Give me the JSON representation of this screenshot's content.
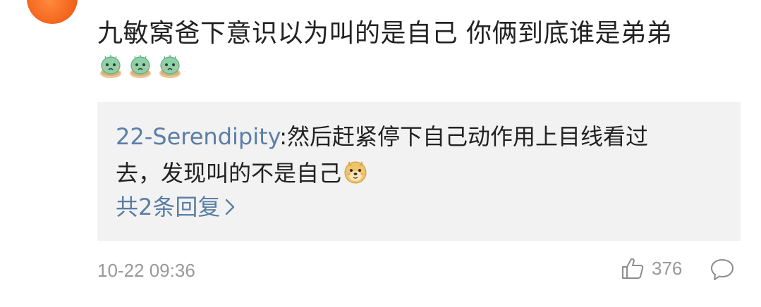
{
  "comment": {
    "text": "九敏窝爸下意识以为叫的是自己 你俩到底谁是弟弟",
    "emojis": [
      "cactus-face-emoji",
      "cactus-face-emoji",
      "cactus-face-emoji"
    ]
  },
  "reply": {
    "username": "22-Serendipity",
    "separator": ":",
    "text": "然后赶紧停下自己动作用上目线看过去，发现叫的不是自己",
    "trailing_emoji": "doge-emoji",
    "more_label": "共2条回复"
  },
  "footer": {
    "timestamp": "10-22 09:36",
    "like_count": "376",
    "like_icon": "thumbs-up-icon",
    "comment_icon": "speech-bubble-icon"
  },
  "colors": {
    "link_blue": "#5b7ea6",
    "reply_bg": "#f2f2f2",
    "meta_gray": "#999999",
    "text_dark": "#222222",
    "avatar_orange": "#f3641c"
  }
}
